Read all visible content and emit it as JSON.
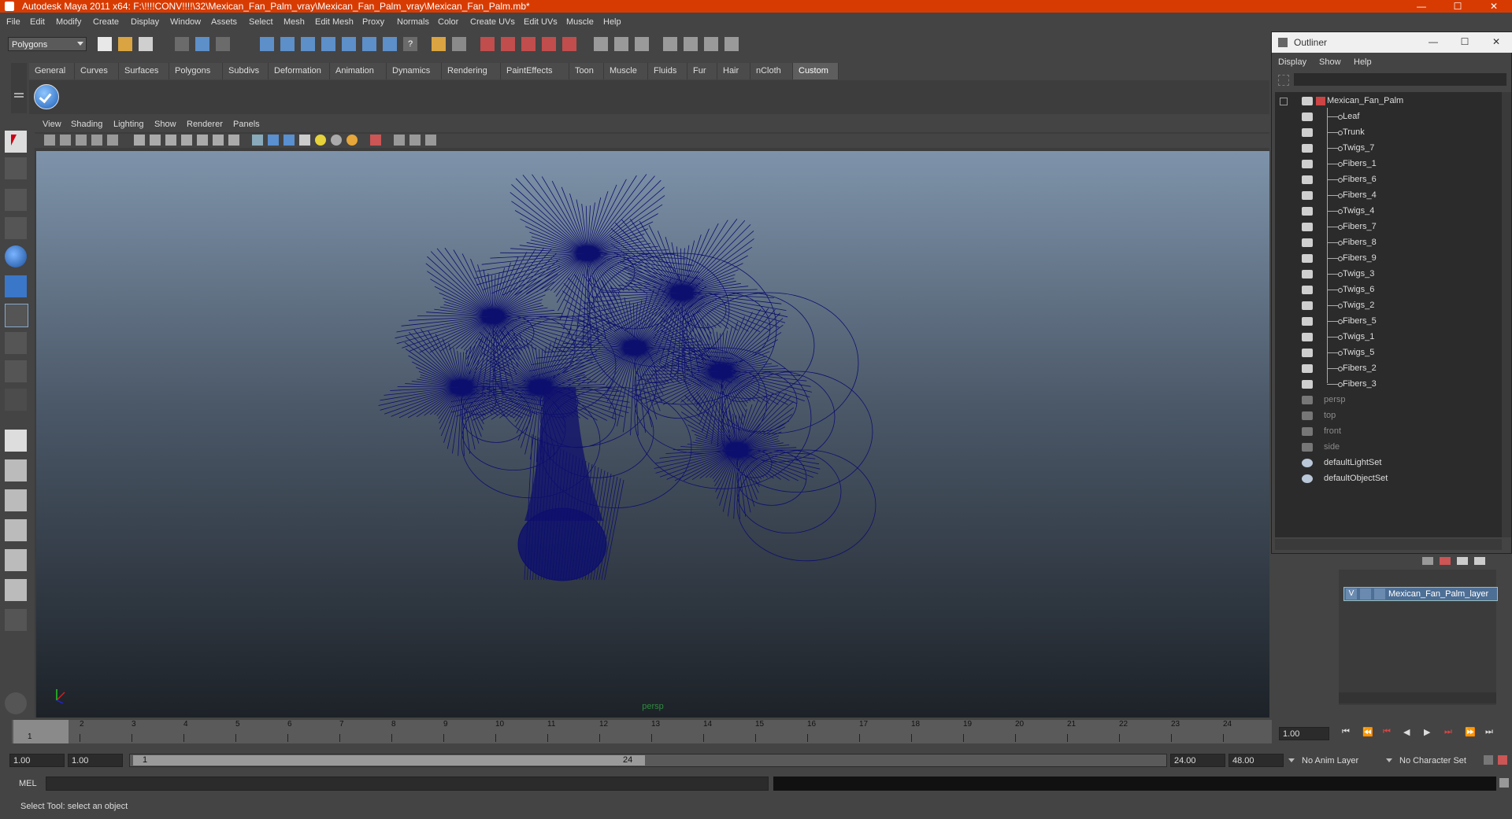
{
  "window": {
    "title": "Autodesk Maya 2011 x64: F:\\!!!!CONV!!!!\\32\\Mexican_Fan_Palm_vray\\Mexican_Fan_Palm_vray\\Mexican_Fan_Palm.mb*",
    "minimize": "—",
    "maximize": "☐",
    "close": "✕"
  },
  "menubar": [
    "File",
    "Edit",
    "Modify",
    "Create",
    "Display",
    "Window",
    "Assets",
    "Select",
    "Mesh",
    "Edit Mesh",
    "Proxy",
    "Normals",
    "Color",
    "Create UVs",
    "Edit UVs",
    "Muscle",
    "Help"
  ],
  "toolbar": {
    "mode": "Polygons"
  },
  "shelf": {
    "tabs": [
      "General",
      "Curves",
      "Surfaces",
      "Polygons",
      "Subdivs",
      "Deformation",
      "Animation",
      "Dynamics",
      "Rendering",
      "PaintEffects",
      "Toon",
      "Muscle",
      "Fluids",
      "Fur",
      "Hair",
      "nCloth",
      "Custom"
    ],
    "active": "Custom"
  },
  "viewport": {
    "menus": [
      "View",
      "Shading",
      "Lighting",
      "Show",
      "Renderer",
      "Panels"
    ],
    "camera_label": "persp",
    "wire_color": "#0d0f6e"
  },
  "timeline": {
    "ticks": [
      "1",
      "2",
      "3",
      "4",
      "5",
      "6",
      "7",
      "8",
      "9",
      "10",
      "11",
      "12",
      "13",
      "14",
      "15",
      "16",
      "17",
      "18",
      "19",
      "20",
      "21",
      "22",
      "23",
      "24"
    ],
    "current_frame": "1",
    "current_time_field": "1.00"
  },
  "range": {
    "start": "1.00",
    "playback_start": "1.00",
    "slider_start": "1",
    "slider_end": "24",
    "playback_end": "24.00",
    "end": "48.00",
    "anim_layer": "No Anim Layer",
    "character_set": "No Character Set"
  },
  "command": {
    "label": "MEL"
  },
  "help": {
    "text": "Select Tool: select an object"
  },
  "outliner": {
    "title": "Outliner",
    "menus": [
      "Display",
      "Show",
      "Help"
    ],
    "root": "Mexican_Fan_Palm",
    "children": [
      "Leaf",
      "Trunk",
      "Twigs_7",
      "Fibers_1",
      "Fibers_6",
      "Fibers_4",
      "Twigs_4",
      "Fibers_7",
      "Fibers_8",
      "Fibers_9",
      "Twigs_3",
      "Twigs_6",
      "Twigs_2",
      "Fibers_5",
      "Twigs_1",
      "Twigs_5",
      "Fibers_2",
      "Fibers_3"
    ],
    "cameras": [
      "persp",
      "top",
      "front",
      "side"
    ],
    "sets": [
      "defaultLightSet",
      "defaultObjectSet"
    ]
  },
  "layers": {
    "visible_flag": "V",
    "name": "Mexican_Fan_Palm_layer"
  }
}
